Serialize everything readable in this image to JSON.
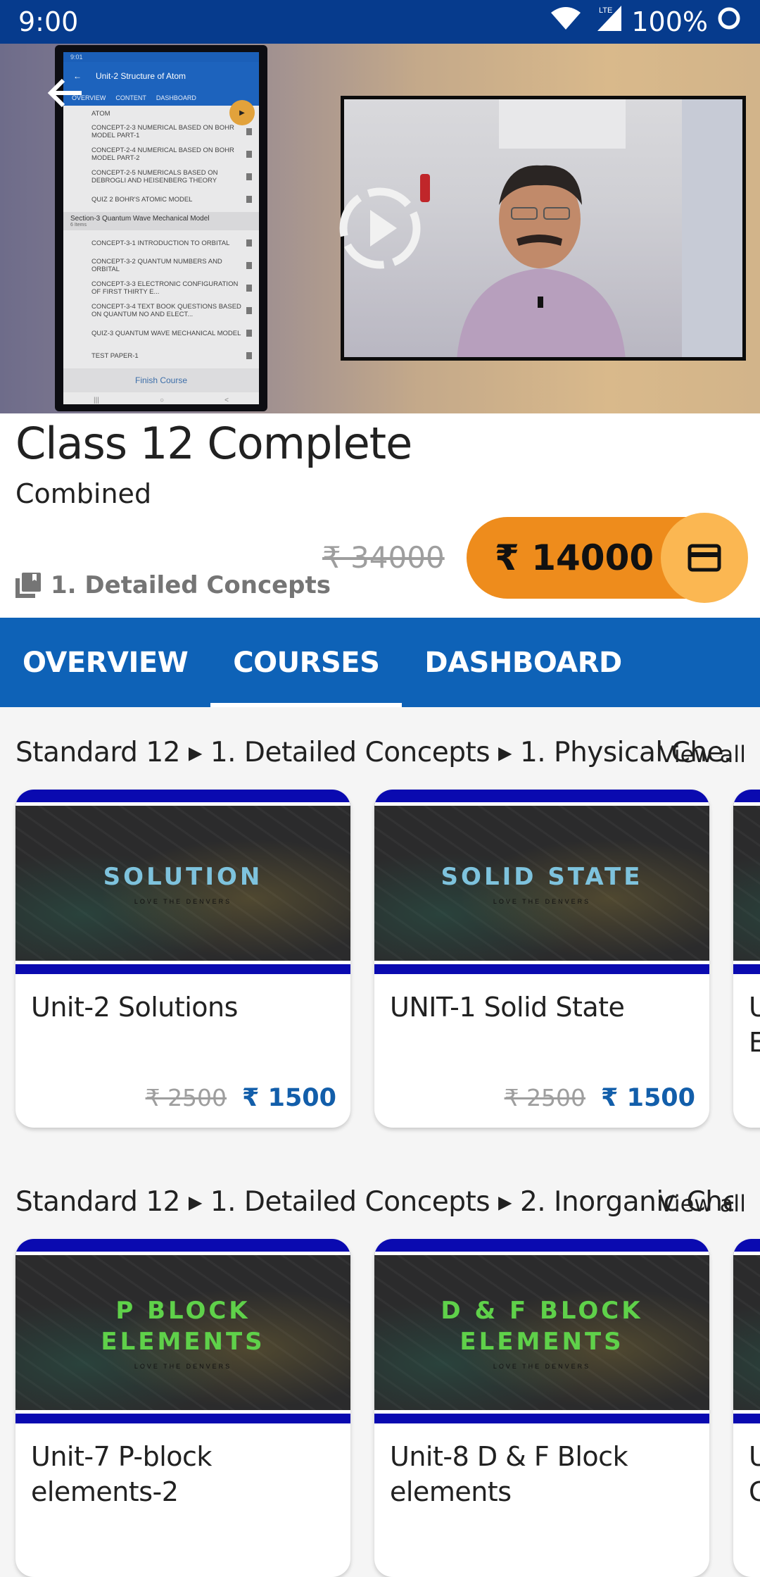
{
  "status_bar": {
    "time": "9:00",
    "network": "LTE",
    "battery": "100%",
    "icons": [
      "wifi-icon",
      "lte-signal-icon",
      "battery-saver-icon"
    ]
  },
  "hero": {
    "back_icon": "back-arrow-icon",
    "play_icon": "play-icon",
    "embedded_phone": {
      "time": "9:01",
      "title": "Unit-2 Structure of Atom",
      "tabs": [
        "OVERVIEW",
        "CONTENT",
        "DASHBOARD"
      ],
      "items_top": [
        "ATOM",
        "CONCEPT-2-3 NUMERICAL BASED ON BOHR MODEL PART-1",
        "CONCEPT-2-4 NUMERICAL BASED ON BOHR MODEL PART-2",
        "CONCEPT-2-5 NUMERICALS BASED ON DEBROGLI AND HEISENBERG THEORY",
        "QUIZ 2  BOHR'S ATOMIC MODEL"
      ],
      "section": {
        "title": "Section-3 Quantum Wave Mechanical Model",
        "count": "6 Items"
      },
      "items_bottom": [
        "CONCEPT-3-1 INTRODUCTION TO ORBITAL",
        "CONCEPT-3-2 QUANTUM NUMBERS AND ORBITAL",
        "CONCEPT-3-3 ELECTRONIC CONFIGURATION OF FIRST THIRTY E...",
        "CONCEPT-3-4 TEXT BOOK QUESTIONS BASED ON QUANTUM NO AND ELECT...",
        "QUIZ-3 QUANTUM WAVE MECHANICAL MODEL",
        "TEST PAPER-1"
      ],
      "finish_label": "Finish Course",
      "nav": [
        "|||",
        "○",
        "<"
      ]
    }
  },
  "course": {
    "title": "Class 12 Complete",
    "subtitle": "Combined",
    "category": "1. Detailed Concepts",
    "old_price": "₹ 34000",
    "price": "₹ 14000",
    "buy_icon": "credit-card-icon"
  },
  "tabs": [
    {
      "label": "OVERVIEW",
      "active": false
    },
    {
      "label": "COURSES",
      "active": true
    },
    {
      "label": "DASHBOARD",
      "active": false
    }
  ],
  "sections": [
    {
      "breadcrumb": "Standard 12 ▸ 1. Detailed Concepts ▸ 1. Physical Che...",
      "view_all": "View all",
      "cards": [
        {
          "thumb_label": "SOLUTION",
          "thumb_color": "#7ec3dd",
          "name": "Unit-2 Solutions",
          "old_price": "₹ 2500",
          "price": "₹ 1500"
        },
        {
          "thumb_label": "SOLID STATE",
          "thumb_color": "#7ec3dd",
          "name": "UNIT-1 Solid State",
          "old_price": "₹ 2500",
          "price": "₹ 1500"
        },
        {
          "thumb_label": "",
          "thumb_color": "#7ec3dd",
          "name": "U\nE",
          "old_price": "",
          "price": ""
        }
      ]
    },
    {
      "breadcrumb": "Standard 12 ▸ 1. Detailed Concepts ▸ 2. Inorganic Che...",
      "view_all": "View all",
      "cards": [
        {
          "thumb_label": "P BLOCK\nELEMENTS",
          "thumb_color": "#5fd14a",
          "name": "Unit-7 P-block\nelements-2",
          "old_price": "",
          "price": ""
        },
        {
          "thumb_label": "D & F BLOCK\nELEMENTS",
          "thumb_color": "#5fd14a",
          "name": "Unit-8 D & F Block\nelements",
          "old_price": "",
          "price": ""
        },
        {
          "thumb_label": "",
          "thumb_color": "#5fd14a",
          "name": "U\nC",
          "old_price": "",
          "price": ""
        }
      ]
    }
  ],
  "thumb_tagline": "LOVE THE DENVERS",
  "colors": {
    "status_bar": "#063b8d",
    "tab_bar": "#0e62b7",
    "buy_button": "#ee8c1c",
    "buy_icon_circle": "#fbb752",
    "price_blue": "#125eaa"
  }
}
